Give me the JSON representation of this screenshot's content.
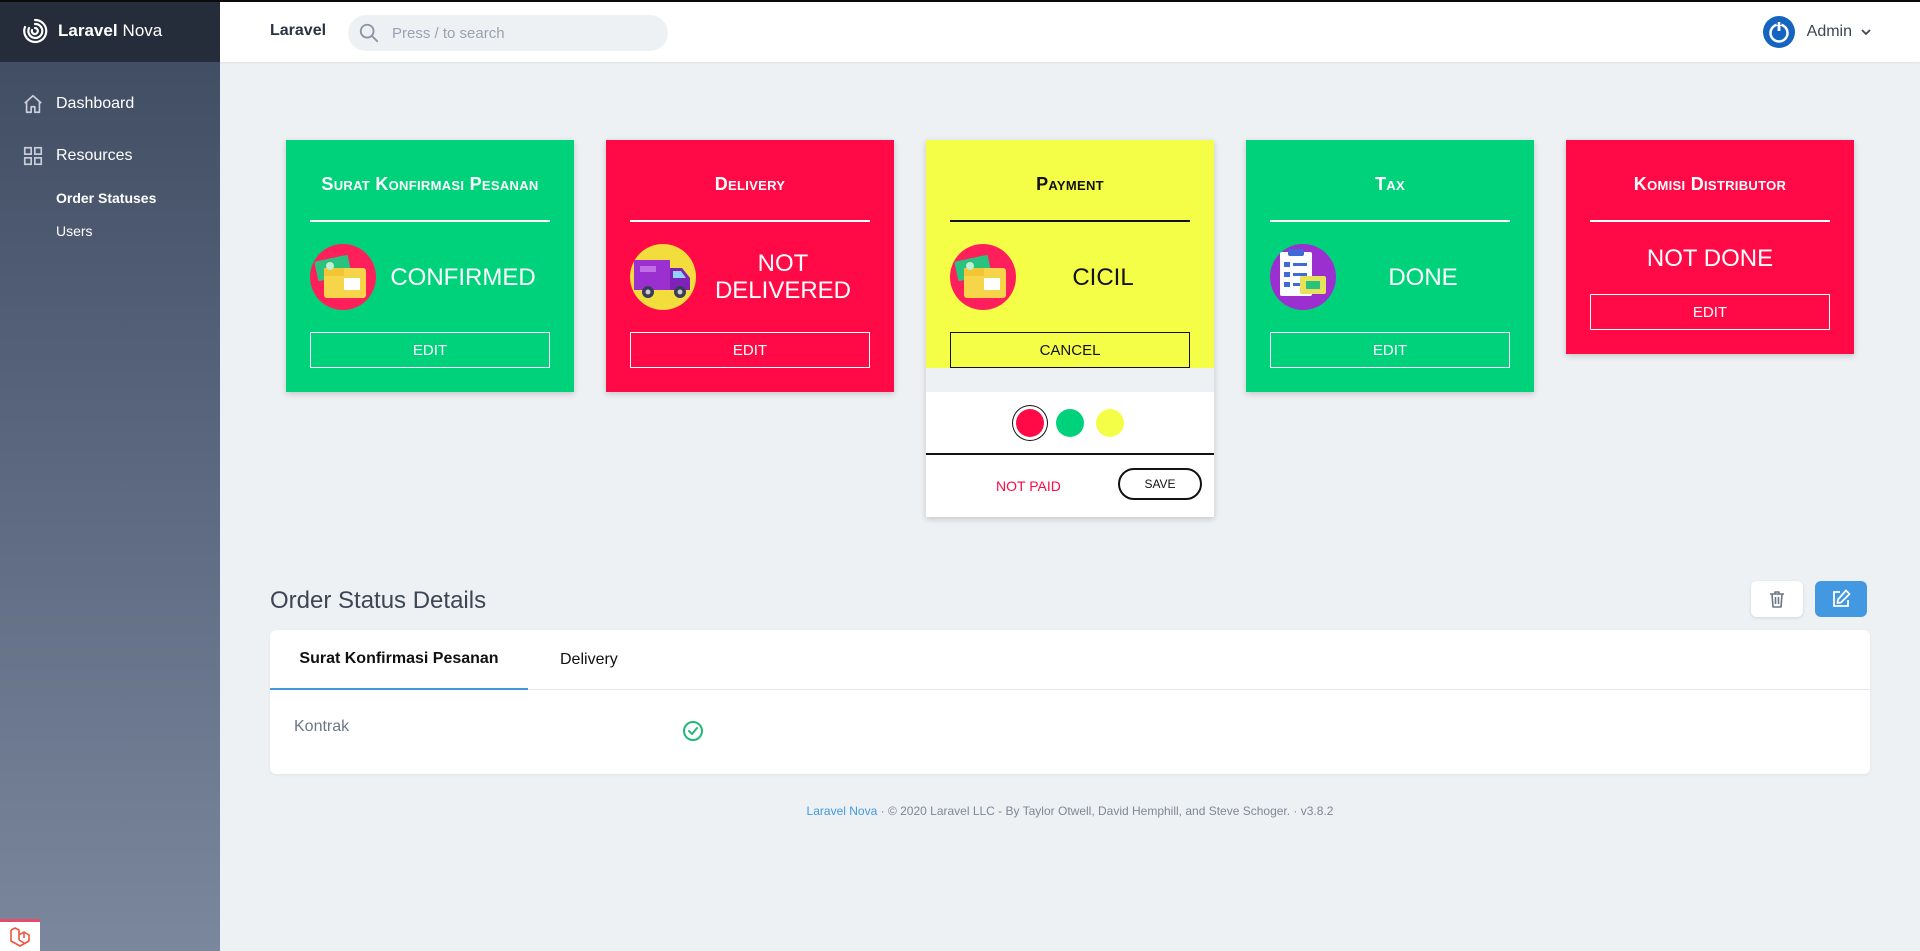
{
  "sidebar": {
    "brand_bold": "Laravel",
    "brand_light": "Nova",
    "dashboard": "Dashboard",
    "resources": "Resources",
    "sub_items": [
      "Order Statuses",
      "Users"
    ]
  },
  "header": {
    "app_name": "Laravel",
    "search_placeholder": "Press / to search",
    "user_name": "Admin"
  },
  "cards": [
    {
      "title": "Surat Konfirmasi Pesanan",
      "status": "CONFIRMED",
      "button": "EDIT",
      "color": "#00d27b",
      "icon": "money-folder-icon"
    },
    {
      "title": "Delivery",
      "status": "NOT DELIVERED",
      "button": "EDIT",
      "color": "#ff0a46",
      "icon": "delivery-truck-icon"
    },
    {
      "title": "Payment",
      "status": "CICIL",
      "button": "CANCEL",
      "color": "#f5fe47",
      "icon": "money-folder-icon"
    },
    {
      "title": "Tax",
      "status": "DONE",
      "button": "EDIT",
      "color": "#00d27b",
      "icon": "clipboard-checklist-icon"
    },
    {
      "title": "Komisi Distributor",
      "status": "NOT DONE",
      "button": "EDIT",
      "color": "#ff0a46"
    }
  ],
  "popup": {
    "status_label": "NOT PAID",
    "save_label": "SAVE",
    "swatches": [
      "#ff0a46",
      "#00d27b",
      "#f5fe47"
    ]
  },
  "details": {
    "title": "Order Status Details",
    "tabs": [
      "Surat Konfirmasi Pesanan",
      "Delivery"
    ],
    "field_label": "Kontrak"
  },
  "footer": {
    "link": "Laravel Nova",
    "text": "·  © 2020 Laravel LLC - By Taylor Otwell, David Hemphill, and Steve Schoger.  ·  v3.8.2"
  }
}
